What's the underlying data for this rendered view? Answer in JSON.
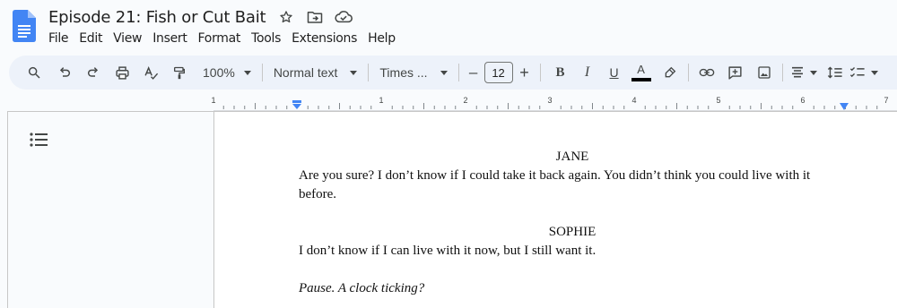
{
  "document": {
    "title": "Episode 21: Fish or Cut Bait"
  },
  "menu": [
    "File",
    "Edit",
    "View",
    "Insert",
    "Format",
    "Tools",
    "Extensions",
    "Help"
  ],
  "toolbar": {
    "zoom": "100%",
    "style": "Normal text",
    "font": "Times ...",
    "font_size": "12",
    "minus": "–",
    "plus": "+",
    "bold": "B",
    "italic": "I",
    "underline": "U",
    "text_color": "A"
  },
  "ruler": {
    "numbers": [
      "1",
      "1",
      "2",
      "3",
      "4",
      "5",
      "6",
      "7"
    ]
  },
  "script": {
    "char1": "JANE",
    "line1": "Are you sure? I don’t know if I could take it back again. You didn’t think you could live with it before.",
    "char2": "SOPHIE",
    "line2": "I don’t know if I can live with it now, but I still want it.",
    "direction": "Pause. A clock ticking?"
  },
  "colors": {
    "brand_blue": "#4285f4",
    "toolbar_bg": "#edf2fa",
    "ruler_marker": "#4285f4"
  }
}
